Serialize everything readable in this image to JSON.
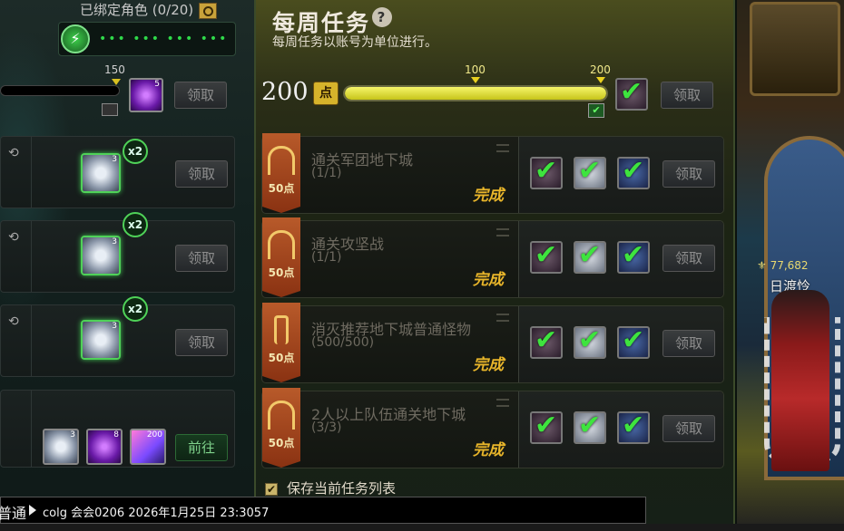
{
  "left": {
    "bound_roles": "已绑定角色 (0/20)",
    "level_marker": "150",
    "orb_count": "5",
    "claim_label": "领取",
    "rows": [
      {
        "multiplier": "x2",
        "item_count": "3",
        "button": "领取"
      },
      {
        "multiplier": "x2",
        "item_count": "3",
        "button": "领取"
      },
      {
        "multiplier": "x2",
        "item_count": "3",
        "button": "领取"
      }
    ],
    "bottom_row": {
      "item1_count": "3",
      "item2_count": "8",
      "item3_count": "200",
      "button": "前往"
    }
  },
  "weekly": {
    "title": "每周任务",
    "subtitle": "每周任务以账号为单位进行。",
    "points": "200",
    "points_icon": "点",
    "marker_100": "100",
    "marker_200": "200",
    "progress_fraction": 1.0,
    "claim_label": "领取",
    "tasks": [
      {
        "points": "50点",
        "name": "通关军团地下城",
        "progress": "(1/1)",
        "status": "完成",
        "button": "领取"
      },
      {
        "points": "50点",
        "name": "通关攻坚战",
        "progress": "(1/1)",
        "status": "完成",
        "button": "领取"
      },
      {
        "points": "50点",
        "name": "消灭推荐地下城普通怪物",
        "progress": "(500/500)",
        "status": "完成",
        "button": "领取"
      },
      {
        "points": "50点",
        "name": "2人以上队伍通关地下城",
        "progress": "(3/3)",
        "status": "完成",
        "button": "领取"
      }
    ],
    "save_checkbox": "保存当前任务列表"
  },
  "game": {
    "gold": "77,682",
    "character_name": "日渡怜"
  },
  "chat": {
    "tab": "普通",
    "message": "colg 会会0206 2026年1月25日 23:3057"
  },
  "colors": {
    "accent_green": "#3ee43e",
    "gold": "#e8b52a",
    "banner": "#b85a2a"
  }
}
